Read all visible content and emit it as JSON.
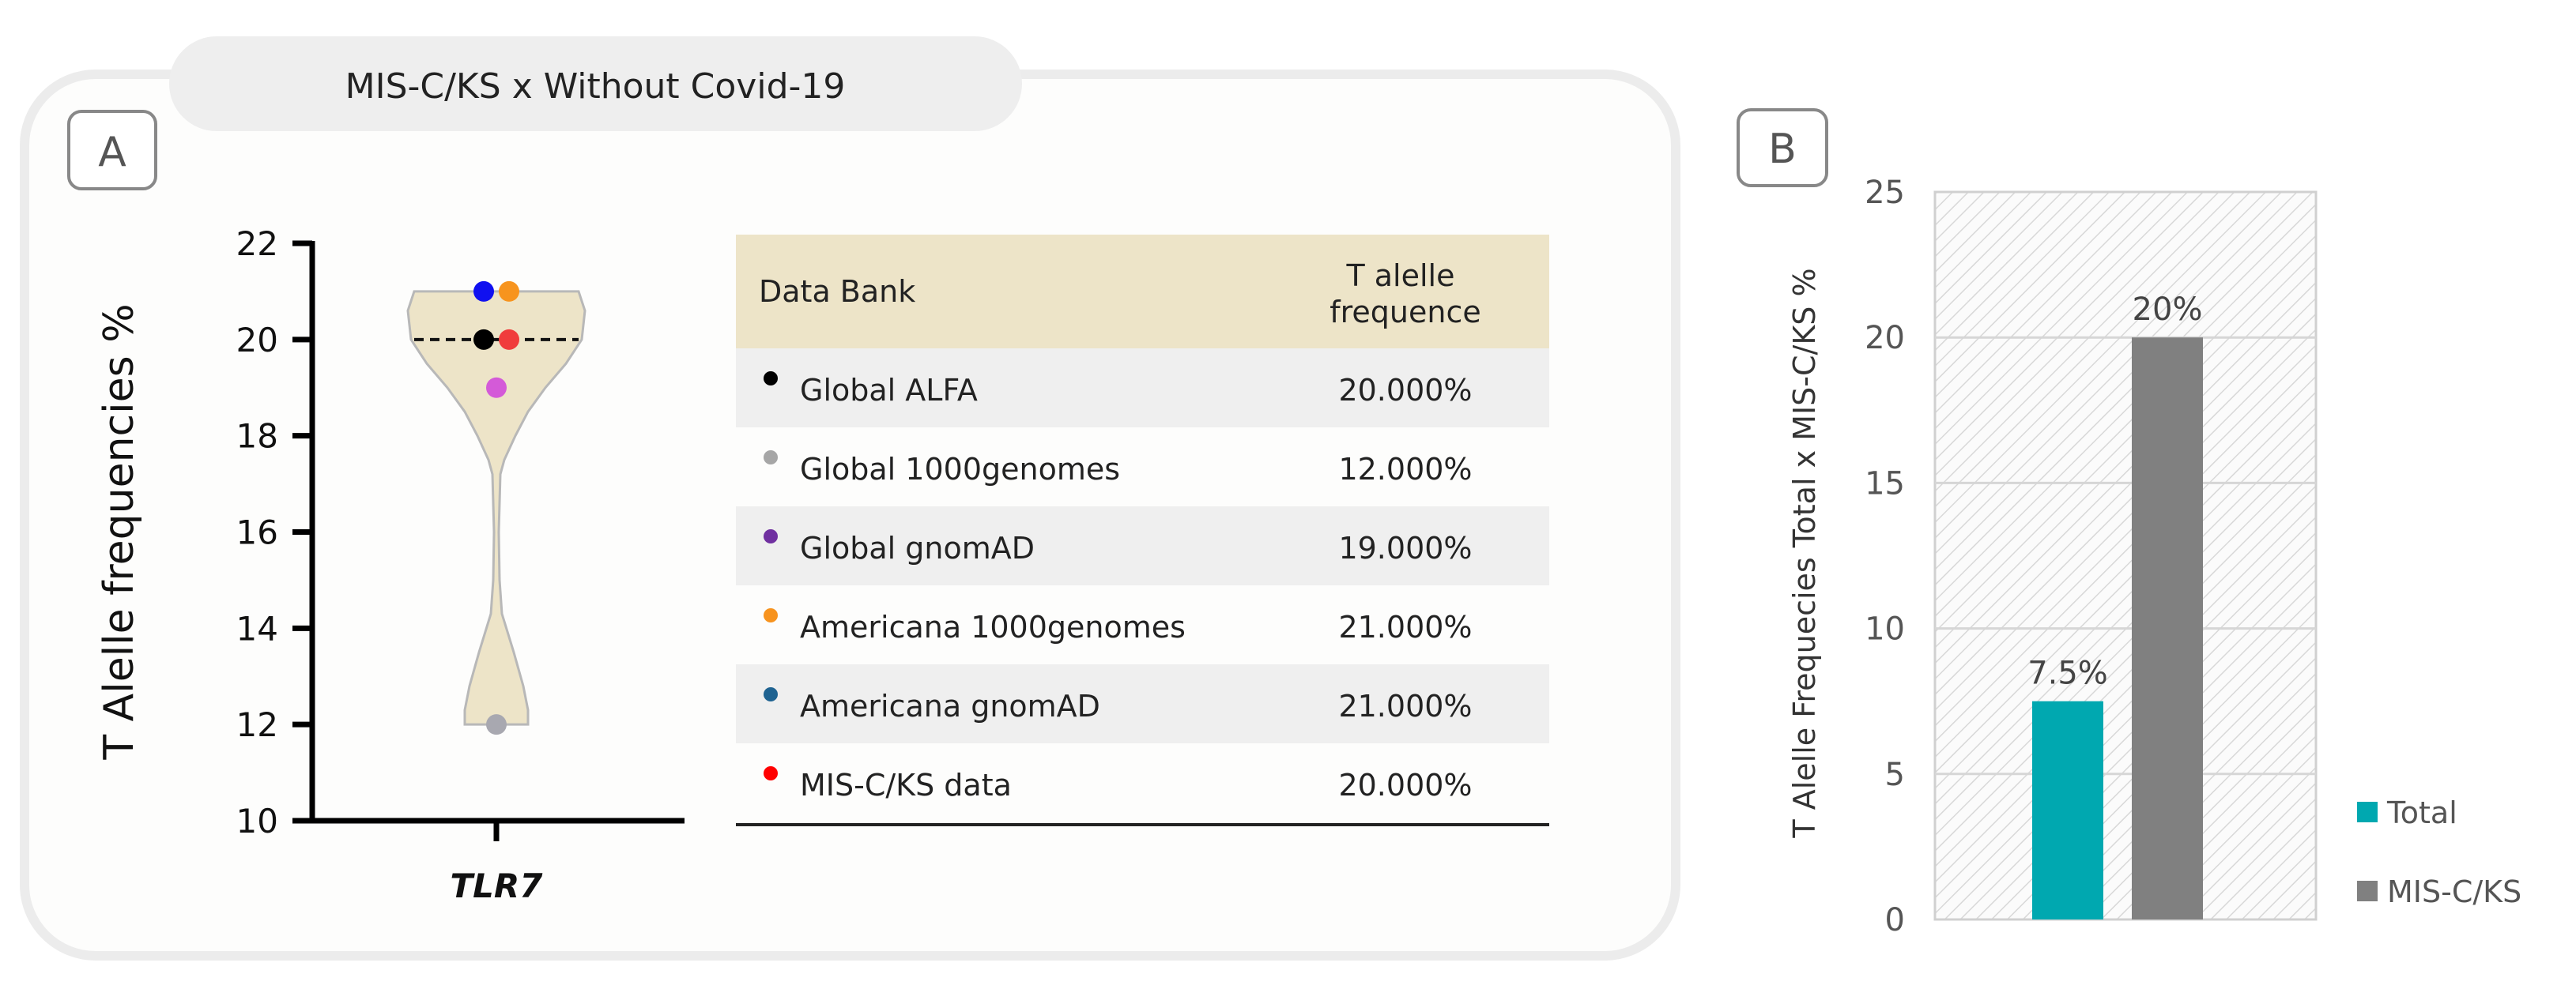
{
  "panel_a": {
    "title": "MIS-C/KS x Without Covid-19",
    "label": "A"
  },
  "panel_b": {
    "label": "B"
  },
  "chart_data": [
    {
      "type": "scatter",
      "subtype": "violin",
      "ylabel": "T Alelle frequencies %",
      "xlabel": "",
      "categories": [
        "TLR7"
      ],
      "ylim": [
        10,
        22
      ],
      "yticks": [
        "10",
        "12",
        "14",
        "16",
        "18",
        "20",
        "22"
      ],
      "median": 20,
      "points": [
        {
          "name": "Global ALFA",
          "value": 20,
          "color": "#000000",
          "offset": "left"
        },
        {
          "name": "Global 1000genomes",
          "value": 12,
          "color": "#a8a8b0",
          "offset": "center"
        },
        {
          "name": "Global gnomAD",
          "value": 19,
          "color": "#d45ad8",
          "offset": "center"
        },
        {
          "name": "Americana 1000genomes",
          "value": 21,
          "color": "#f7941e",
          "offset": "right"
        },
        {
          "name": "Americana gnomAD",
          "value": 21,
          "color": "#1010f0",
          "offset": "left"
        },
        {
          "name": "MIS-C/KS data",
          "value": 20,
          "color": "#f03c3c",
          "offset": "right"
        }
      ]
    },
    {
      "type": "table",
      "columns": [
        "Data Bank",
        "T alelle frequence"
      ],
      "rows": [
        {
          "bank": "Global ALFA",
          "value": "20.000%",
          "dot": "#000000"
        },
        {
          "bank": "Global 1000genomes",
          "value": "12.000%",
          "dot": "#a6a6a6"
        },
        {
          "bank": "Global gnomAD",
          "value": "19.000%",
          "dot": "#7030a0"
        },
        {
          "bank": "Americana 1000genomes",
          "value": "21.000%",
          "dot": "#f7931e"
        },
        {
          "bank": "Americana gnomAD",
          "value": "21.000%",
          "dot": "#1f6391"
        },
        {
          "bank": "MIS-C/KS data",
          "value": "20.000%",
          "dot": "#ff0000"
        }
      ],
      "header_color": "#ede4c8",
      "stripe_color": "#efefef"
    },
    {
      "type": "bar",
      "ylabel": "T Alelle Frequecies Total x MIS-C/KS %",
      "xlabel": "",
      "ylim": [
        0,
        25
      ],
      "yticks": [
        "0",
        "5",
        "10",
        "15",
        "20",
        "25"
      ],
      "series": [
        {
          "name": "Total",
          "value": 7.5,
          "label": "7.5%",
          "color": "#00a8b0"
        },
        {
          "name": "MIS-C/KS",
          "value": 20,
          "label": "20%",
          "color": "#808080"
        }
      ],
      "legend": "right",
      "grid": true
    }
  ]
}
